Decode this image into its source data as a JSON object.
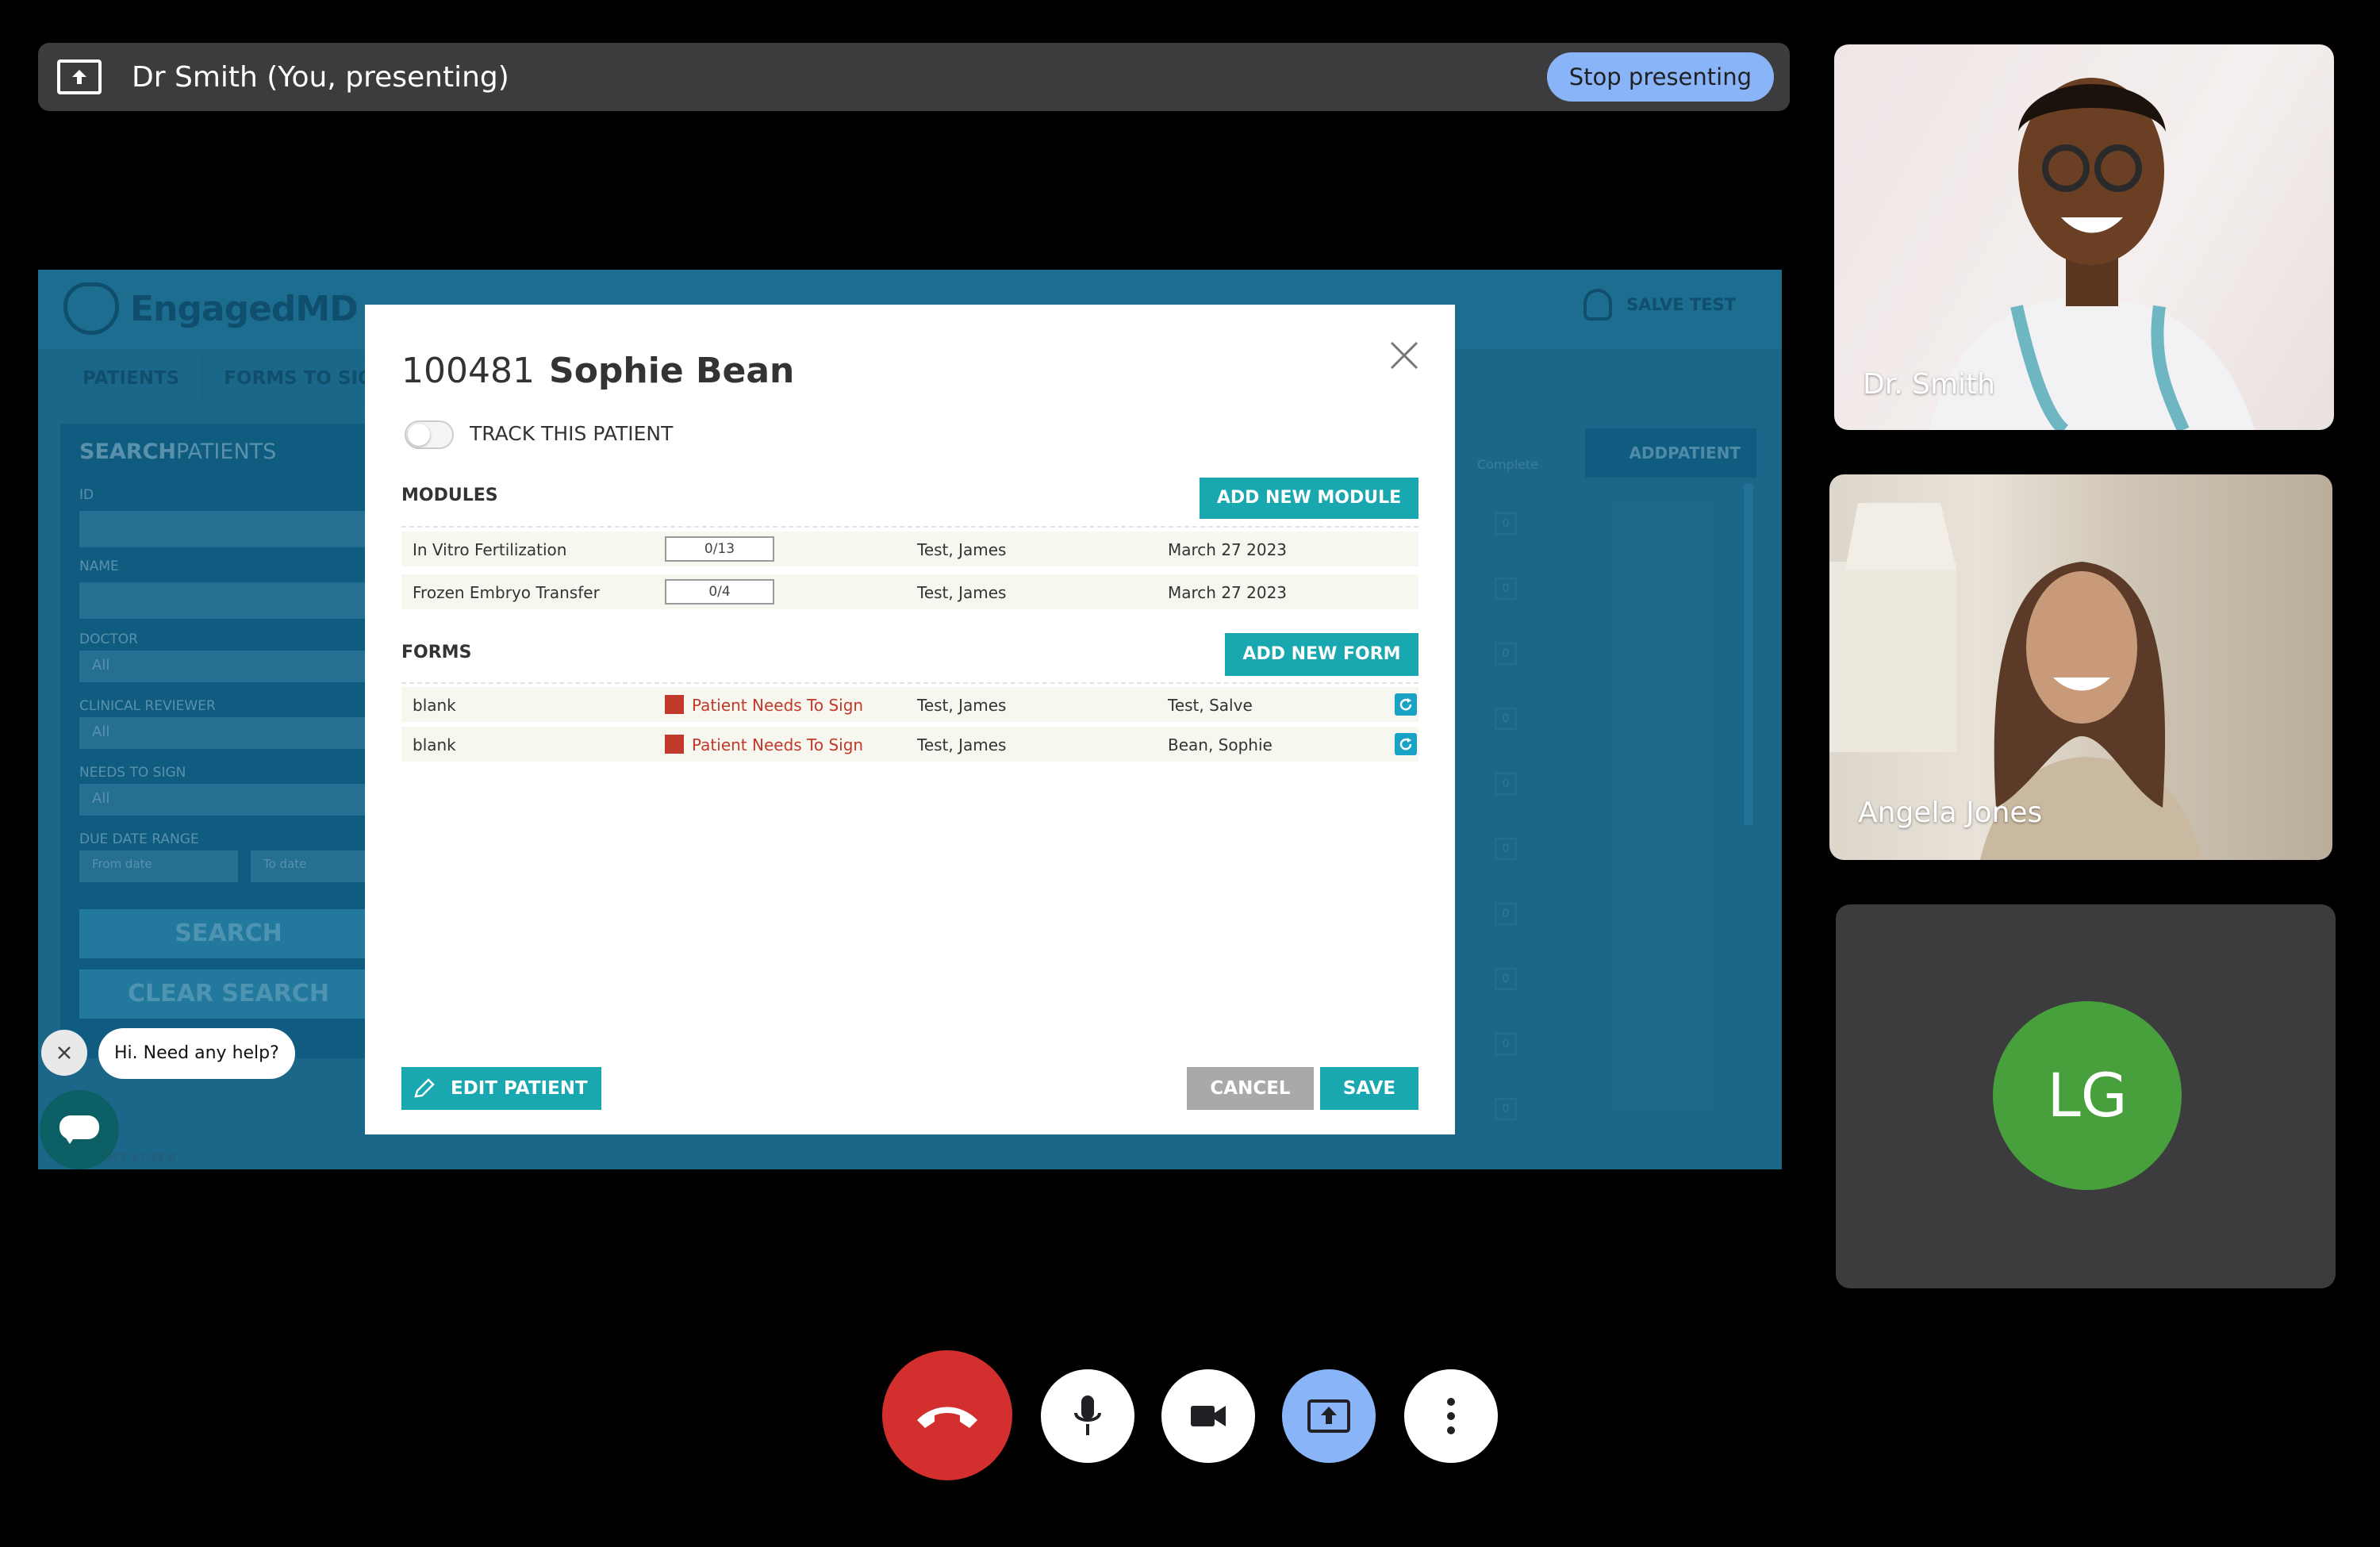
{
  "presenting_bar": {
    "title": "Dr Smith (You, presenting)",
    "stop_label": "Stop presenting"
  },
  "shared_app": {
    "logo": "EngagedMD",
    "user": "SALVE TEST",
    "tabs": [
      "PATIENTS",
      "FORMS TO SIGN"
    ],
    "search": {
      "title_bold": "SEARCH",
      "title_rest": "PATIENTS",
      "fields": [
        {
          "label": "ID",
          "value": ""
        },
        {
          "label": "NAME",
          "value": ""
        },
        {
          "label": "DOCTOR",
          "value": "All"
        },
        {
          "label": "CLINICAL REVIEWER",
          "value": "All"
        },
        {
          "label": "NEEDS TO SIGN",
          "value": "All"
        },
        {
          "label": "DUE DATE RANGE",
          "value": ""
        }
      ],
      "from_placeholder": "From date",
      "to_placeholder": "To date",
      "search_label": "SEARCH",
      "clear_label": "CLEAR SEARCH"
    },
    "complete_label": "Complete",
    "add_patient_label": "ADDPATIENT",
    "row_count_values": [
      "0",
      "0",
      "0",
      "0",
      "0",
      "0",
      "0",
      "0",
      "0",
      "0"
    ],
    "footer": "POLICY   V7.12.0"
  },
  "modal": {
    "patient_id": "100481",
    "patient_name": "Sophie Bean",
    "track_label": "TRACK THIS PATIENT",
    "modules_title": "MODULES",
    "add_module_label": "ADD NEW MODULE",
    "modules": [
      {
        "name": "In Vitro Fertilization",
        "progress": "0/13",
        "doctor": "Test, James",
        "date": "March 27 2023"
      },
      {
        "name": "Frozen Embryo Transfer",
        "progress": "0/4",
        "doctor": "Test, James",
        "date": "March 27 2023"
      }
    ],
    "forms_title": "FORMS",
    "add_form_label": "ADD NEW FORM",
    "forms": [
      {
        "name": "blank",
        "status": "Patient Needs To Sign",
        "doctor": "Test, James",
        "signer": "Test, Salve"
      },
      {
        "name": "blank",
        "status": "Patient Needs To Sign",
        "doctor": "Test, James",
        "signer": "Bean, Sophie"
      }
    ],
    "edit_label": "EDIT PATIENT",
    "cancel_label": "CANCEL",
    "save_label": "SAVE"
  },
  "chat_widget": {
    "bubble": "Hi. Need any help?"
  },
  "participants": [
    {
      "name": "Dr. Smith"
    },
    {
      "name": "Angela Jones"
    },
    {
      "initials": "LG",
      "color": "#47a03b"
    }
  ],
  "controls": {
    "hangup_color": "#d32f2f",
    "share_color": "#8ab4f8"
  }
}
